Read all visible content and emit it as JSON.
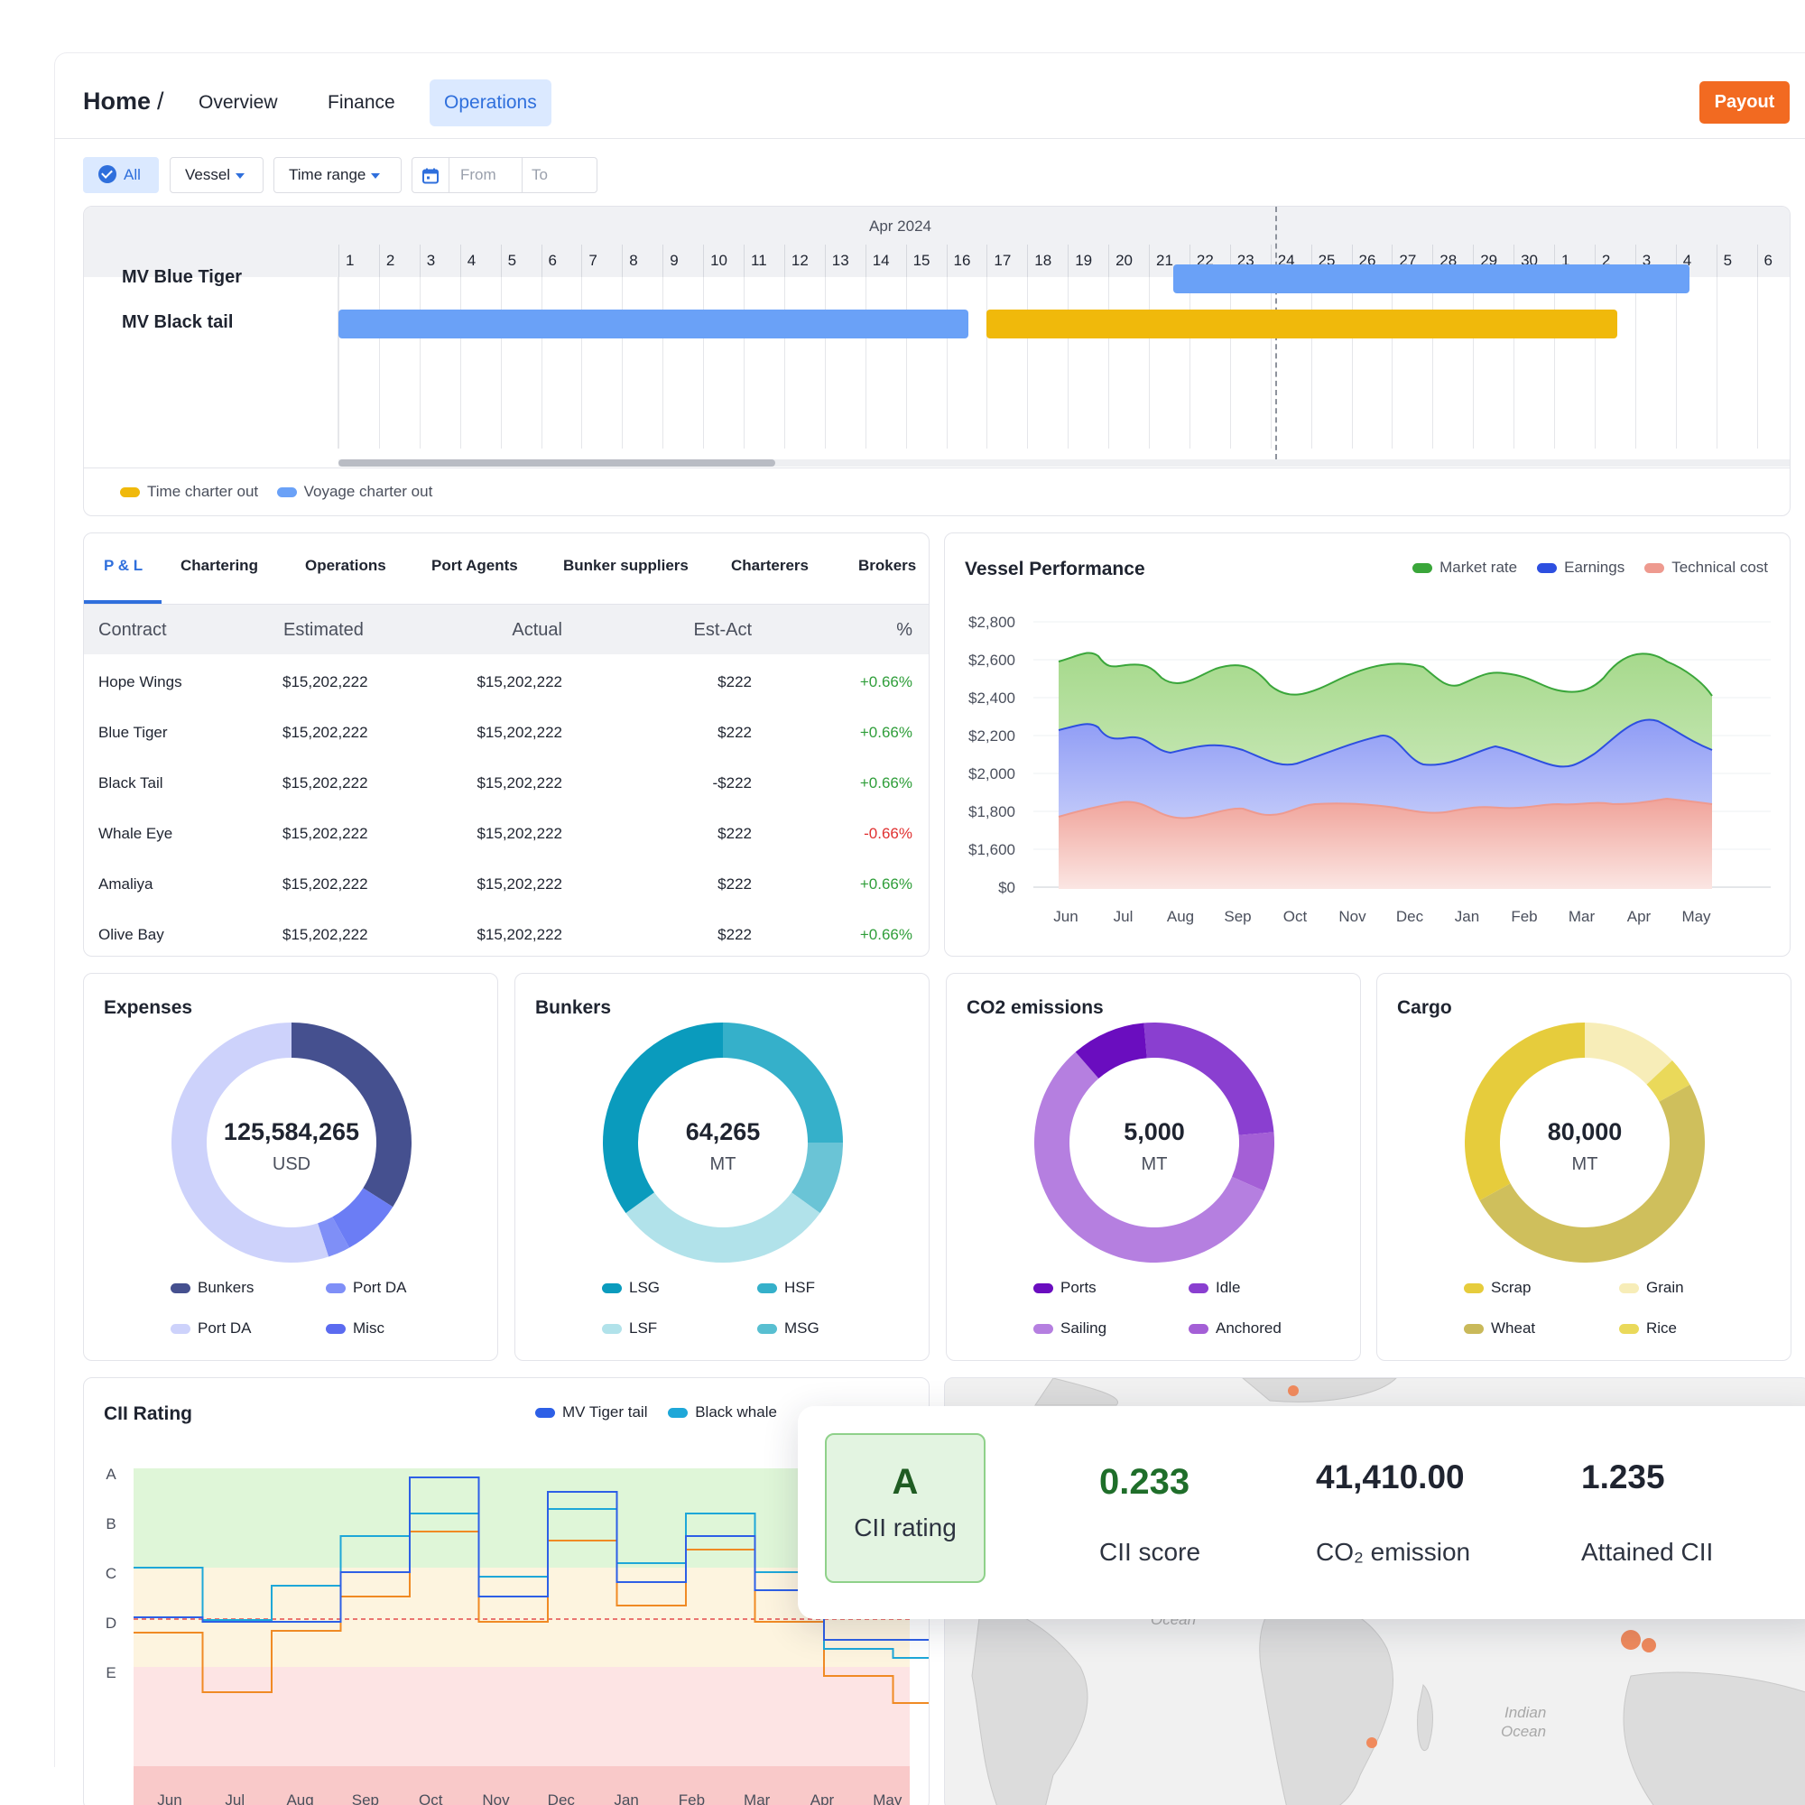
{
  "header": {
    "home": "Home",
    "sep": "/",
    "tabs": [
      {
        "label": "Overview"
      },
      {
        "label": "Finance"
      },
      {
        "label": "Operations"
      }
    ],
    "payout": "Payout"
  },
  "filters": {
    "all": "All",
    "vessel": "Vessel",
    "time_range": "Time range",
    "from": "From",
    "to": "To"
  },
  "gantt": {
    "month_label": "Apr 2024",
    "days": [
      "1",
      "2",
      "3",
      "4",
      "5",
      "6",
      "7",
      "8",
      "9",
      "10",
      "11",
      "12",
      "13",
      "14",
      "15",
      "16",
      "17",
      "18",
      "19",
      "20",
      "21",
      "22",
      "23",
      "24",
      "25",
      "26",
      "27",
      "28",
      "29",
      "30",
      "1",
      "2",
      "3",
      "4",
      "5",
      "6"
    ],
    "today_day_index": 23,
    "vessels": [
      {
        "name": "MV Blue Tiger",
        "bars": [
          {
            "start": 20.6,
            "end": 33.35,
            "kind": "voyage"
          }
        ]
      },
      {
        "name": "MV Black tail",
        "bars": [
          {
            "start": 0,
            "end": 15.55,
            "kind": "voyage"
          },
          {
            "start": 16.0,
            "end": 31.55,
            "kind": "time"
          }
        ]
      }
    ],
    "legend": [
      {
        "label": "Time charter out",
        "color": "#f0b90b"
      },
      {
        "label": "Voyage charter out",
        "color": "#6aa1f7"
      }
    ],
    "colors": {
      "voyage": "#6aa1f7",
      "time": "#f0b90b"
    }
  },
  "pnl": {
    "tabs": [
      "P & L",
      "Chartering",
      "Operations",
      "Port Agents",
      "Bunker suppliers",
      "Charterers",
      "Brokers"
    ],
    "columns": [
      "Contract",
      "Estimated",
      "Actual",
      "Est-Act",
      "%"
    ],
    "rows": [
      {
        "contract": "Hope Wings",
        "estimated": "$15,202,222",
        "actual": "$15,202,222",
        "diff": "$222",
        "pct": "+0.66%",
        "sign": "pos"
      },
      {
        "contract": "Blue Tiger",
        "estimated": "$15,202,222",
        "actual": "$15,202,222",
        "diff": "$222",
        "pct": "+0.66%",
        "sign": "pos"
      },
      {
        "contract": "Black Tail",
        "estimated": "$15,202,222",
        "actual": "$15,202,222",
        "diff": "-$222",
        "pct": "+0.66%",
        "sign": "pos"
      },
      {
        "contract": "Whale Eye",
        "estimated": "$15,202,222",
        "actual": "$15,202,222",
        "diff": "$222",
        "pct": "-0.66%",
        "sign": "neg"
      },
      {
        "contract": "Amaliya",
        "estimated": "$15,202,222",
        "actual": "$15,202,222",
        "diff": "$222",
        "pct": "+0.66%",
        "sign": "pos"
      },
      {
        "contract": "Olive Bay",
        "estimated": "$15,202,222",
        "actual": "$15,202,222",
        "diff": "$222",
        "pct": "+0.66%",
        "sign": "pos"
      }
    ]
  },
  "vessel_perf": {
    "title": "Vessel Performance",
    "legend": [
      {
        "label": "Market rate",
        "color": "#3aa63a"
      },
      {
        "label": "Earnings",
        "color": "#2d4fe0"
      },
      {
        "label": "Technical cost",
        "color": "#ee9a8f"
      }
    ],
    "y_ticks": [
      "$2,800",
      "$2,600",
      "$2,400",
      "$2,200",
      "$2,000",
      "$1,800",
      "$1,600",
      "$0"
    ],
    "x_ticks": [
      "Jun",
      "Jul",
      "Aug",
      "Sep",
      "Oct",
      "Nov",
      "Dec",
      "Jan",
      "Feb",
      "Mar",
      "Apr",
      "May"
    ]
  },
  "donuts": [
    {
      "title": "Expenses",
      "value": "125,584,265",
      "unit": "USD",
      "segments": [
        {
          "label": "Bunkers",
          "value": 34,
          "color": "#45508f"
        },
        {
          "label": "Port DA",
          "value": 8,
          "color": "#6b7df5"
        },
        {
          "label": "Port DA",
          "value": 3,
          "color": "#7f8ff7"
        },
        {
          "label": "Misc",
          "value": 55,
          "color": "#cdd2fb"
        }
      ],
      "legend": [
        {
          "label": "Bunkers",
          "color": "#45508f"
        },
        {
          "label": "Port DA",
          "color": "#7f8ff7"
        },
        {
          "label": "Port DA",
          "color": "#cdd2fb"
        },
        {
          "label": "Misc",
          "color": "#5b6bf0"
        }
      ]
    },
    {
      "title": "Bunkers",
      "value": "64,265",
      "unit": "MT",
      "segments": [
        {
          "label": "HSF",
          "value": 25,
          "color": "#35b0ca"
        },
        {
          "label": "MSG",
          "value": 10,
          "color": "#6ac4d6"
        },
        {
          "label": "LSF",
          "value": 30,
          "color": "#b1e2ea"
        },
        {
          "label": "LSG",
          "value": 35,
          "color": "#0a9bbd"
        }
      ],
      "legend": [
        {
          "label": "LSG",
          "color": "#0a9bbd"
        },
        {
          "label": "HSF",
          "color": "#35b0ca"
        },
        {
          "label": "LSF",
          "color": "#b1e2ea"
        },
        {
          "label": "MSG",
          "color": "#58bfd1"
        }
      ]
    },
    {
      "title": "CO2 emissions",
      "value": "5,000",
      "unit": "MT",
      "segments": [
        {
          "label": "Idle",
          "value": 25,
          "color": "#8a3fd0"
        },
        {
          "label": "Anchored",
          "value": 8,
          "color": "#a45fd6"
        },
        {
          "label": "Sailing",
          "value": 57,
          "color": "#b57fe0"
        },
        {
          "label": "Ports",
          "value": 10,
          "color": "#6a0dbf"
        }
      ],
      "legend": [
        {
          "label": "Ports",
          "color": "#6a0dbf"
        },
        {
          "label": "Idle",
          "color": "#8a3fd0"
        },
        {
          "label": "Sailing",
          "color": "#b57fe0"
        },
        {
          "label": "Anchored",
          "color": "#a45fd6"
        }
      ],
      "first_start": -95
    },
    {
      "title": "Cargo",
      "value": "80,000",
      "unit": "MT",
      "segments": [
        {
          "label": "Grain",
          "value": 13,
          "color": "#f7edb8"
        },
        {
          "label": "Rice",
          "value": 4,
          "color": "#ead95a"
        },
        {
          "label": "Wheat",
          "value": 50,
          "color": "#cfbf5c"
        },
        {
          "label": "Scrap",
          "value": 33,
          "color": "#e6cc3c"
        }
      ],
      "legend": [
        {
          "label": "Scrap",
          "color": "#e6cc3c"
        },
        {
          "label": "Grain",
          "color": "#f7edb8"
        },
        {
          "label": "Wheat",
          "color": "#c9b95a"
        },
        {
          "label": "Rice",
          "color": "#ead95a"
        }
      ]
    }
  ],
  "cii": {
    "title": "CII Rating",
    "legend": [
      {
        "label": "MV Tiger tail",
        "color": "#2d5fe6"
      },
      {
        "label": "Black whale",
        "color": "#1ea7d8"
      }
    ],
    "y_ticks": [
      "A",
      "B",
      "C",
      "D",
      "E"
    ],
    "x_ticks": [
      "Jun",
      "Jul",
      "Aug",
      "Sep",
      "Oct",
      "Nov",
      "Dec",
      "Jan",
      "Feb",
      "Mar",
      "Apr",
      "May"
    ]
  },
  "cii_summary": {
    "rating": "A",
    "rating_label": "CII rating",
    "score": "0.233",
    "score_label": "CII score",
    "emission": "41,410.00",
    "emission_label": "CO₂ emission",
    "attained": "1.235",
    "attained_label": "Attained CII"
  },
  "map": {
    "labels": [
      "Ocean",
      "Indian",
      "Ocean"
    ]
  }
}
